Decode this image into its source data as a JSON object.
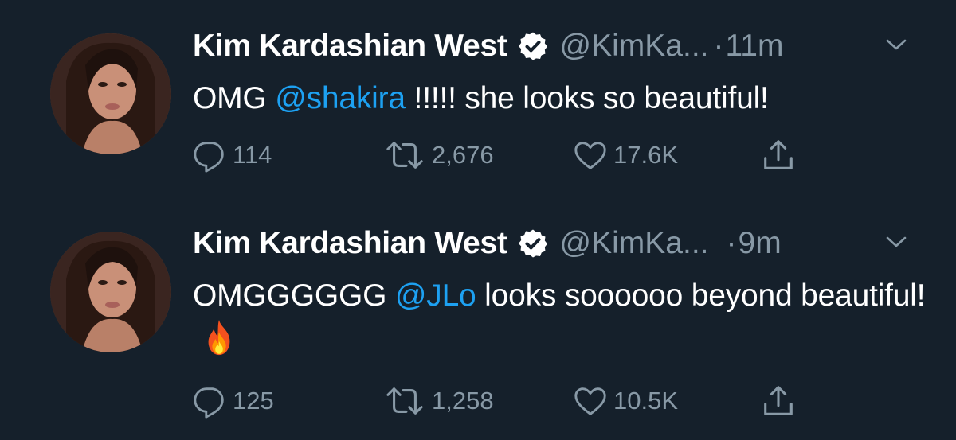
{
  "tweets": [
    {
      "author_name": "Kim Kardashian West",
      "handle": "@KimKa...",
      "separator": "·",
      "time": "11m",
      "text_prefix": "OMG ",
      "mention": "@shakira",
      "text_suffix": " !!!!! she looks so beautiful!",
      "replies": "114",
      "retweets": "2,676",
      "likes": "17.6K"
    },
    {
      "author_name": "Kim Kardashian West",
      "handle": "@KimKa...",
      "separator": "·",
      "time": "9m",
      "text_prefix": "OMGGGGGG ",
      "mention": "@JLo",
      "text_suffix": " looks soooooo beyond beautiful!",
      "emoji": "fire-emoji",
      "replies": "125",
      "retweets": "1,258",
      "likes": "10.5K"
    }
  ],
  "colors": {
    "background": "#15202b",
    "text": "#ffffff",
    "secondary": "#8899a6",
    "link": "#1da1f2",
    "divider": "#38444d"
  },
  "icons": [
    "verified-icon",
    "chevron-down-icon",
    "reply-icon",
    "retweet-icon",
    "like-icon",
    "share-icon"
  ]
}
